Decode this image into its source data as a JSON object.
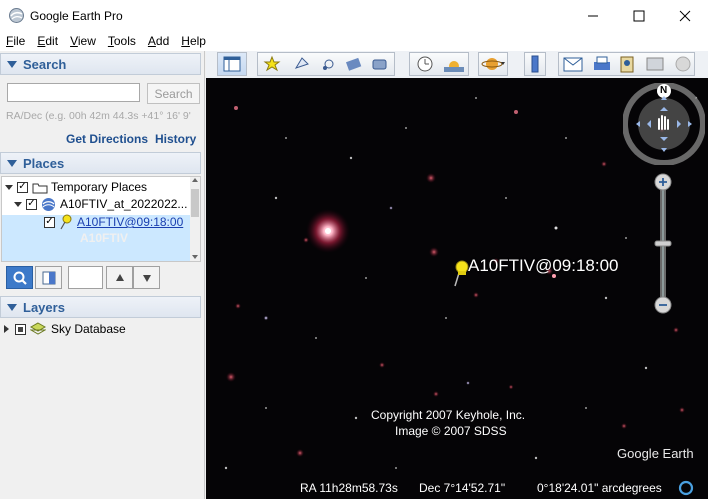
{
  "window": {
    "title": "Google Earth Pro",
    "controls": {
      "minimize": "─",
      "maximize": "☐",
      "close": "✕"
    }
  },
  "menu": [
    {
      "key": "F",
      "rest": "ile"
    },
    {
      "key": "E",
      "rest": "dit"
    },
    {
      "key": "V",
      "rest": "iew"
    },
    {
      "key": "T",
      "rest": "ools"
    },
    {
      "key": "A",
      "rest": "dd"
    },
    {
      "key": "H",
      "rest": "elp"
    }
  ],
  "search": {
    "heading": "Search",
    "input_value": "",
    "button_label": "Search",
    "hint": "RA/Dec (e.g. 00h 42m 44.3s +41° 16' 9'",
    "get_directions": "Get Directions",
    "history": "History"
  },
  "places": {
    "heading": "Places",
    "root": "Temporary Places",
    "folder": "A10FTIV_at_2022022...",
    "item": "A10FTIV@09:18:00",
    "item_sub": "A10FTIV"
  },
  "layers": {
    "heading": "Layers",
    "items": [
      "Sky Database"
    ]
  },
  "map": {
    "placemark_label": "A10FTIV@09:18:00",
    "copyright_line1": "Copyright 2007 Keyhole, Inc.",
    "copyright_line2": "Image © 2007 SDSS",
    "logo": "Google Earth",
    "compass_north": "N",
    "status": {
      "ra": "RA  11h28m58.73s",
      "dec": "Dec  7°14'52.71\"",
      "altitude": "0°18'24.01\" arcdegrees"
    }
  },
  "colors": {
    "accent": "#2f5f99",
    "selection": "#cce8ff",
    "sky": "#050406",
    "pushpin": "#f5e21a"
  }
}
